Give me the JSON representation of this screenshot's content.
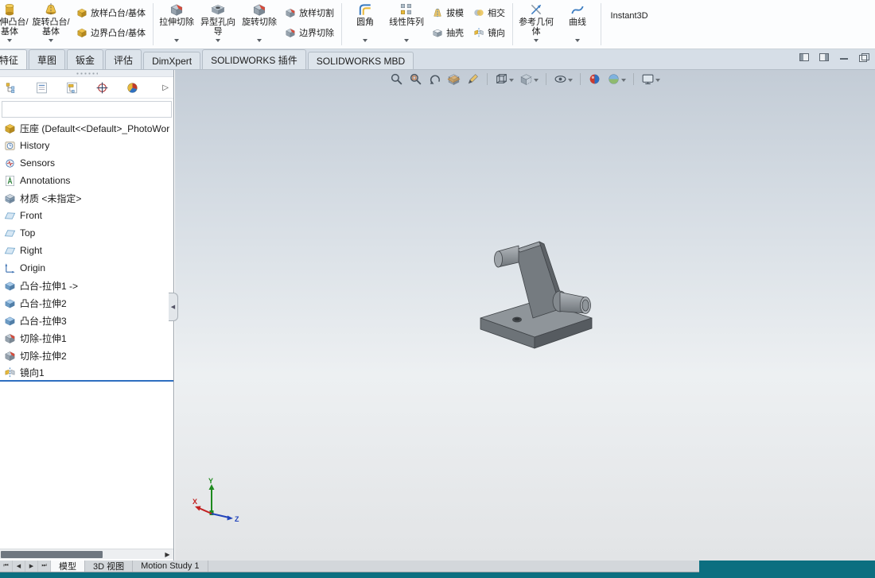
{
  "ribbon": {
    "items": [
      {
        "label": "拉伸凸台/基体",
        "icon": "extrude-boss-icon"
      },
      {
        "label": "旋转凸台/基体",
        "icon": "revolve-boss-icon"
      },
      {
        "label": "放样凸台/基体",
        "icon": "loft-boss-icon"
      },
      {
        "label": "边界凸台/基体",
        "icon": "boundary-boss-icon"
      },
      {
        "label": "拉伸切除",
        "icon": "extrude-cut-icon"
      },
      {
        "label": "异型孔向导",
        "icon": "hole-wizard-icon"
      },
      {
        "label": "旋转切除",
        "icon": "revolve-cut-icon"
      },
      {
        "label": "放样切割",
        "icon": "loft-cut-icon"
      },
      {
        "label": "边界切除",
        "icon": "boundary-cut-icon"
      },
      {
        "label": "圆角",
        "icon": "fillet-icon"
      },
      {
        "label": "线性阵列",
        "icon": "linear-pattern-icon"
      },
      {
        "label": "拔模",
        "icon": "draft-icon"
      },
      {
        "label": "抽壳",
        "icon": "shell-icon"
      },
      {
        "label": "相交",
        "icon": "intersect-icon"
      },
      {
        "label": "镜向",
        "icon": "mirror-icon"
      },
      {
        "label": "参考几何体",
        "icon": "reference-geometry-icon"
      },
      {
        "label": "曲线",
        "icon": "curves-icon"
      },
      {
        "label": "Instant3D",
        "icon": "instant3d-icon"
      }
    ]
  },
  "command_tabs": {
    "active": "特征",
    "items": [
      {
        "label": "特征"
      },
      {
        "label": "草图"
      },
      {
        "label": "钣金"
      },
      {
        "label": "评估"
      },
      {
        "label": "DimXpert"
      },
      {
        "label": "SOLIDWORKS 插件"
      },
      {
        "label": "SOLIDWORKS MBD"
      }
    ]
  },
  "manager_tabs": [
    "feature-manager-icon",
    "property-manager-icon",
    "configuration-manager-icon",
    "dimxpert-manager-icon",
    "display-manager-icon"
  ],
  "feature_tree": {
    "root": {
      "label": "压座 (Default<<Default>_PhotoWor",
      "icon": "part-icon"
    },
    "items": [
      {
        "label": "History",
        "icon": "history-icon"
      },
      {
        "label": "Sensors",
        "icon": "sensors-icon"
      },
      {
        "label": "Annotations",
        "icon": "annotations-icon"
      },
      {
        "label": "材质 <未指定>",
        "icon": "material-icon"
      },
      {
        "label": "Front",
        "icon": "plane-icon"
      },
      {
        "label": "Top",
        "icon": "plane-icon"
      },
      {
        "label": "Right",
        "icon": "plane-icon"
      },
      {
        "label": "Origin",
        "icon": "origin-icon"
      },
      {
        "label": "凸台-拉伸1 ->",
        "icon": "boss-extrude-icon"
      },
      {
        "label": "凸台-拉伸2",
        "icon": "boss-extrude-icon"
      },
      {
        "label": "凸台-拉伸3",
        "icon": "boss-extrude-icon"
      },
      {
        "label": "切除-拉伸1",
        "icon": "cut-extrude-icon"
      },
      {
        "label": "切除-拉伸2",
        "icon": "cut-extrude-icon"
      },
      {
        "label": "镜向1",
        "icon": "mirror-feature-icon",
        "selected": true
      }
    ]
  },
  "heads_up_toolbar": [
    "zoom-fit-icon",
    "zoom-area-icon",
    "previous-view-icon",
    "section-view-icon",
    "annotation-icon",
    "view-orientation-icon",
    "display-style-icon",
    "hide-show-items-icon",
    "edit-appearance-icon",
    "apply-scene-icon",
    "view-settings-icon"
  ],
  "viewport": {
    "part_name": "压座",
    "triad": {
      "x": "X",
      "y": "Y",
      "z": "Z"
    }
  },
  "bottom_tabs": {
    "active": "模型",
    "items": [
      {
        "label": "模型"
      },
      {
        "label": "3D 视图"
      },
      {
        "label": "Motion Study 1"
      }
    ]
  },
  "colors": {
    "accent": "#2e6fc0",
    "status_bar": "#0c6f80",
    "viewport_gradient_top": "#c3ccd6",
    "viewport_gradient_bottom": "#e2e4e6"
  }
}
